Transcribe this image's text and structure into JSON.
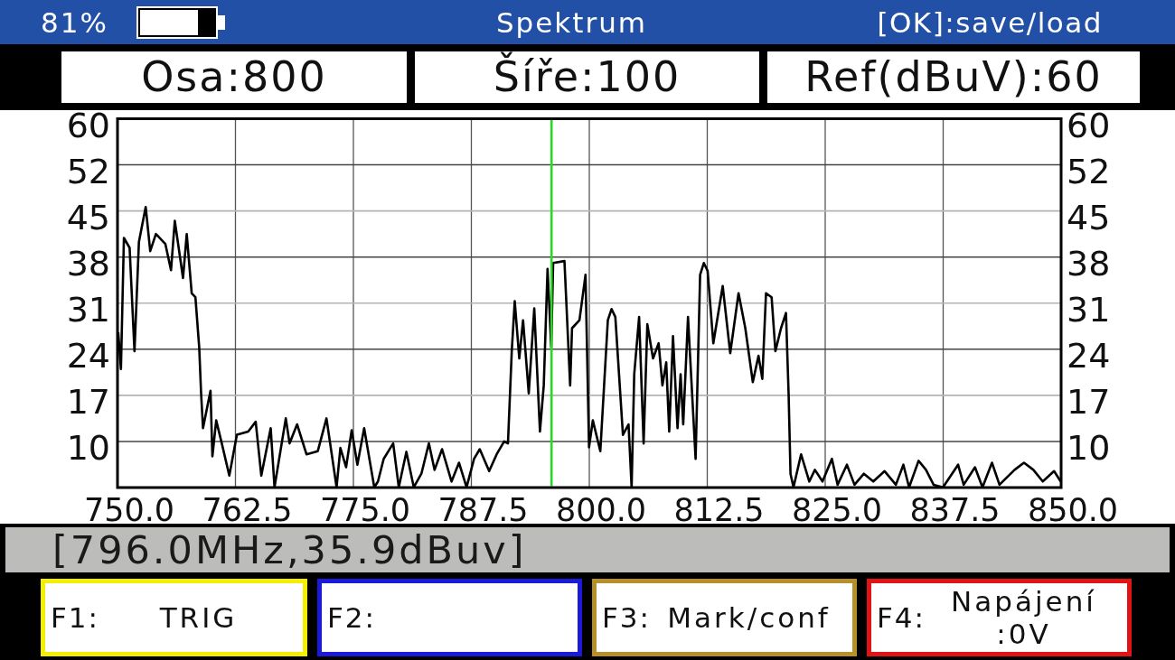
{
  "status_bar": {
    "battery_text": "81%",
    "title": "Spektrum",
    "hint": "[OK]:save/load"
  },
  "parameters": [
    "Osa:800",
    "Šíře:100",
    "Ref(dBuV):60"
  ],
  "spectrum": {
    "chart_data": {
      "type": "line",
      "x": [
        750.08,
        750.36,
        750.68,
        751.28,
        751.8,
        752.27,
        752.99,
        753.47,
        754.07,
        755.07,
        755.67,
        756.07,
        756.94,
        757.34,
        757.86,
        758.26,
        758.66,
        758.86,
        759.06,
        759.86,
        760.06,
        760.46,
        761.05,
        761.85,
        762.65,
        763.85,
        764.65,
        765.24,
        766.24,
        766.64,
        767.84,
        768.24,
        769.03,
        770.03,
        771.23,
        772.15,
        773.22,
        773.62,
        774.22,
        774.82,
        775.42,
        776.14,
        777.21,
        777.61,
        778.21,
        779.21,
        779.81,
        780.61,
        781.4,
        782.2,
        783.0,
        783.6,
        784.4,
        785.4,
        786.19,
        786.99,
        787.79,
        788.39,
        789.39,
        790.18,
        790.98,
        791.38,
        791.78,
        792.1,
        792.58,
        792.98,
        793.58,
        794.17,
        794.77,
        795.17,
        795.57,
        795.97,
        796.17,
        797.37,
        797.97,
        798.17,
        798.96,
        799.6,
        799.97,
        800.37,
        801.17,
        801.96,
        802.36,
        802.76,
        803.56,
        804.16,
        804.48,
        804.76,
        805.28,
        805.76,
        806.15,
        806.75,
        807.35,
        807.75,
        808.15,
        808.47,
        808.87,
        809.35,
        809.67,
        809.95,
        810.46,
        811.26,
        811.74,
        812.14,
        812.54,
        813.14,
        814.14,
        814.93,
        815.81,
        816.53,
        817.33,
        817.93,
        818.33,
        818.73,
        819.32,
        819.72,
        820.32,
        820.84,
        821.12,
        821.32,
        821.64,
        822.44,
        823.31,
        823.91,
        824.71,
        825.71,
        826.31,
        827.3,
        828.1,
        829.1,
        830.1,
        831.29,
        832.49,
        833.29,
        833.89,
        834.89,
        835.68,
        836.48,
        837.48,
        839.08,
        839.67,
        840.87,
        841.67,
        842.67,
        843.47,
        845.07,
        846.06,
        847.06,
        848.06,
        849.25,
        849.95
      ],
      "series": [
        {
          "color": "#000000",
          "values": [
            26.6,
            21,
            40.9,
            39.4,
            23.7,
            40.3,
            45.6,
            38.9,
            41.5,
            40,
            36,
            43.5,
            34.8,
            41.5,
            32.5,
            31.9,
            24.3,
            17.3,
            12,
            17.7,
            7.7,
            13.2,
            9.7,
            4.7,
            11,
            11.5,
            13,
            4.7,
            12,
            2.9,
            13.5,
            9.7,
            12.6,
            8,
            8.5,
            13.5,
            2.9,
            9,
            6,
            11.7,
            6.4,
            12,
            2.9,
            3.8,
            7.3,
            9.7,
            2.9,
            8.4,
            2.9,
            5,
            9.7,
            5.6,
            8.8,
            3.8,
            6.7,
            2.9,
            7.3,
            8.8,
            5.4,
            8,
            10,
            9.7,
            23.7,
            31.3,
            22.6,
            28.4,
            17.3,
            30.2,
            11.5,
            18.5,
            36.2,
            24.3,
            37.1,
            37.4,
            18.5,
            27.2,
            28.4,
            35.3,
            9.1,
            13.2,
            8.5,
            28.4,
            30.1,
            28.9,
            11,
            12.6,
            2.9,
            20.2,
            28.9,
            9.7,
            27.8,
            22.6,
            24.9,
            18.5,
            22,
            11.5,
            26,
            12,
            20.2,
            12.6,
            28.9,
            7.3,
            35.3,
            37.1,
            35.9,
            24.9,
            33.6,
            23.4,
            32.5,
            27.2,
            19,
            23,
            19.5,
            32.5,
            31.9,
            23.7,
            27.2,
            29.5,
            17.3,
            5,
            2.9,
            8,
            3.8,
            5.6,
            3.8,
            7.3,
            3.3,
            6.4,
            3.3,
            5,
            3.8,
            5.4,
            3.3,
            6.4,
            2.9,
            7,
            5.6,
            3.3,
            2.9,
            6.4,
            3.3,
            6,
            2.9,
            6.7,
            3.3,
            5.6,
            6.7,
            5.6,
            3.8,
            5.4,
            3.8
          ]
        }
      ],
      "xlim": [
        750,
        850
      ],
      "ylim": [
        2.86,
        60
      ],
      "xticks": [
        {
          "value": 750,
          "label": "750.0"
        },
        {
          "value": 762.5,
          "label": "762.5"
        },
        {
          "value": 775,
          "label": "775.0"
        },
        {
          "value": 787.5,
          "label": "787.5"
        },
        {
          "value": 800,
          "label": "800.0"
        },
        {
          "value": 812.5,
          "label": "812.5"
        },
        {
          "value": 825,
          "label": "825.0"
        },
        {
          "value": 837.5,
          "label": "837.5"
        },
        {
          "value": 850,
          "label": "850.0"
        }
      ],
      "yticks": [
        {
          "value": 60,
          "label": "60"
        },
        {
          "value": 52,
          "label": "52"
        },
        {
          "value": 45,
          "label": "45"
        },
        {
          "value": 38,
          "label": "38"
        },
        {
          "value": 31,
          "label": "31"
        },
        {
          "value": 24,
          "label": "24"
        },
        {
          "value": 17,
          "label": "17"
        },
        {
          "value": 10,
          "label": "10"
        }
      ],
      "grid": true,
      "ref_lines": [
        {
          "axis": "x",
          "value": 796.0,
          "color": "#1ee01e"
        }
      ]
    },
    "right_axis_labels": [
      "60",
      "52",
      "45",
      "38",
      "31",
      "24",
      "17",
      "10"
    ]
  },
  "marker_readout": "[796.0MHz,35.9dBuv]",
  "function_keys": [
    {
      "key": "F1:",
      "lines": [
        "TRIG"
      ],
      "color": "#f4ee00"
    },
    {
      "key": "F2:",
      "color": "#1a1ad8"
    },
    {
      "key": "F3:",
      "lines": [
        "Mark/conf"
      ],
      "color": "#b8902a"
    },
    {
      "key": "F4:",
      "lines": [
        "Napájení",
        ":0V"
      ],
      "color": "#e01414"
    }
  ]
}
